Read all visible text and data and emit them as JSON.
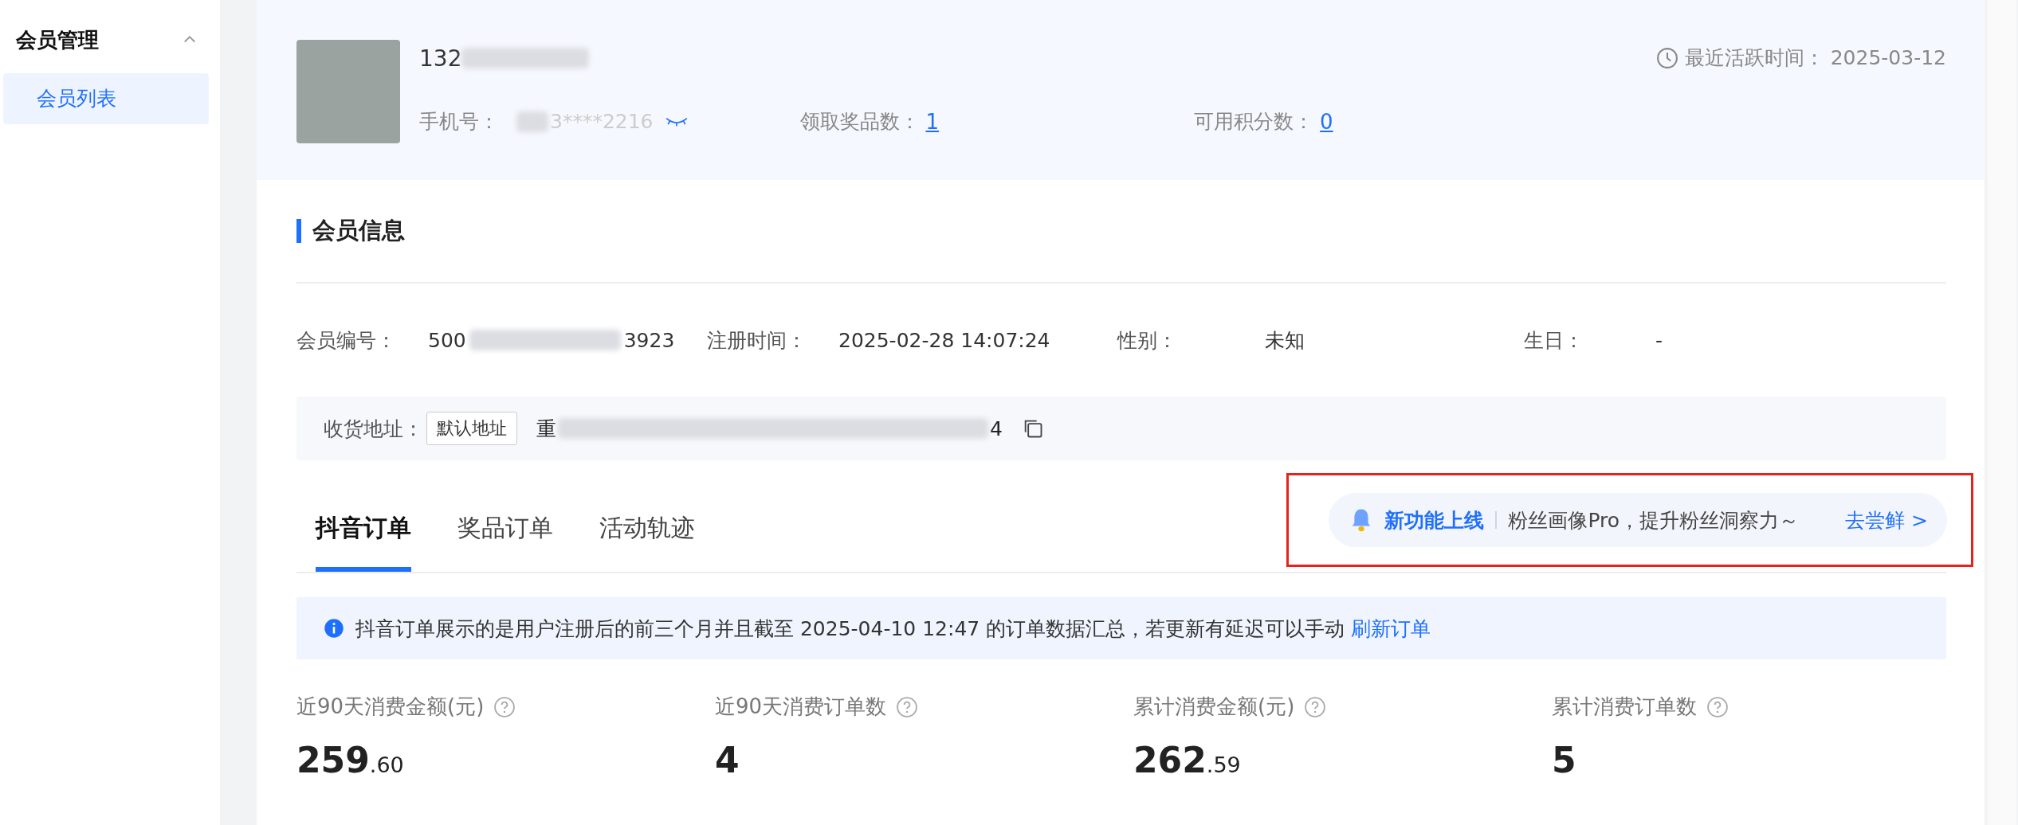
{
  "sidebar": {
    "group": {
      "label": "会员管理",
      "expanded": true
    },
    "items": [
      {
        "label": "会员列表",
        "selected": true
      }
    ]
  },
  "profile": {
    "name_visible": "132",
    "phone_label": "手机号：",
    "phone_visible": "3****2216",
    "prizes_label": "领取奖品数：",
    "prizes_value": "1",
    "points_label": "可用积分数：",
    "points_value": "0",
    "last_active_label": "最近活跃时间：",
    "last_active_value": "2025-03-12"
  },
  "member_info": {
    "title": "会员信息",
    "fields": [
      {
        "label": "会员编号：",
        "value_start": "500",
        "value_end": "3923"
      },
      {
        "label": "注册时间：",
        "value_start": "2025-02-28 14:07:24"
      },
      {
        "label": "性别：",
        "value_start": "未知"
      },
      {
        "label": "生日：",
        "value_start": "-"
      }
    ],
    "address": {
      "label": "收货地址：",
      "tag": "默认地址",
      "value_start": "重",
      "value_end": "4"
    }
  },
  "tabs": [
    {
      "label": "抖音订单",
      "selected": true
    },
    {
      "label": "奖品订单",
      "selected": false
    },
    {
      "label": "活动轨迹",
      "selected": false
    }
  ],
  "promo": {
    "title": "新功能上线",
    "text": "粉丝画像Pro，提升粉丝洞察力～",
    "link": "去尝鲜 >"
  },
  "notice": {
    "text": "抖音订单展示的是用户注册后的前三个月并且截至 2025-04-10 12:47 的订单数据汇总，若更新有延迟可以手动",
    "link": "刷新订单"
  },
  "stats": [
    {
      "label": "近90天消费金额(元)",
      "integer": "259",
      "decimal": ".60"
    },
    {
      "label": "近90天消费订单数",
      "integer": "4"
    },
    {
      "label": "累计消费金额(元)",
      "integer": "262",
      "decimal": ".59"
    },
    {
      "label": "累计消费订单数",
      "integer": "5"
    }
  ]
}
